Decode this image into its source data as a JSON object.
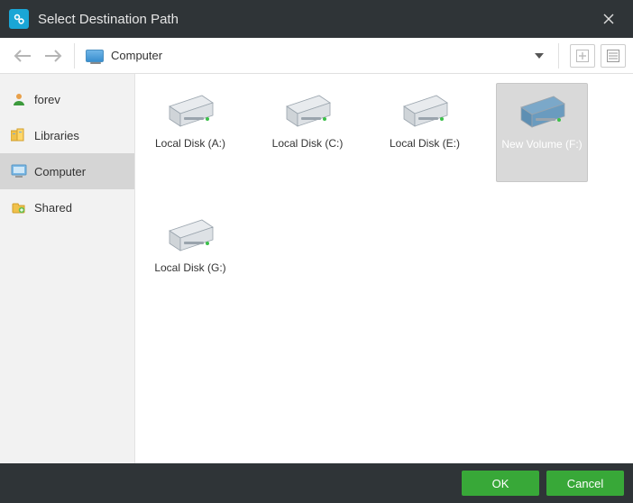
{
  "titlebar": {
    "title": "Select Destination Path"
  },
  "toolbar": {
    "path_label": "Computer"
  },
  "sidebar": {
    "items": [
      {
        "label": "forev"
      },
      {
        "label": "Libraries"
      },
      {
        "label": "Computer"
      },
      {
        "label": "Shared"
      }
    ]
  },
  "drives": [
    {
      "label": "Local Disk (A:)",
      "selected": false
    },
    {
      "label": "Local Disk (C:)",
      "selected": false
    },
    {
      "label": "Local Disk (E:)",
      "selected": false
    },
    {
      "label": "New Volume (F:)",
      "selected": true
    },
    {
      "label": "Local Disk (G:)",
      "selected": false
    }
  ],
  "footer": {
    "ok": "OK",
    "cancel": "Cancel"
  }
}
